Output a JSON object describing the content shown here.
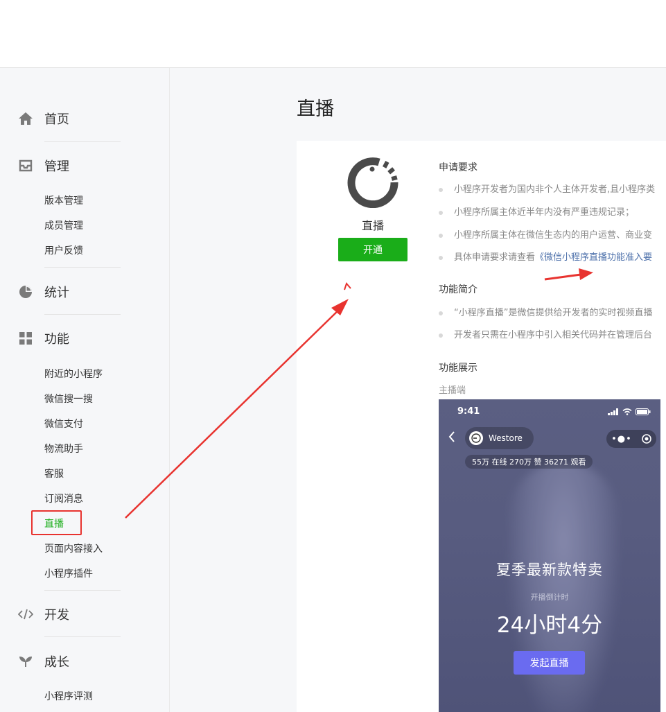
{
  "sidebar": {
    "sections": [
      {
        "label": "首页",
        "icon": "home-icon"
      },
      {
        "label": "管理",
        "icon": "inbox-icon",
        "items": [
          "版本管理",
          "成员管理",
          "用户反馈"
        ]
      },
      {
        "label": "统计",
        "icon": "pie-chart-icon"
      },
      {
        "label": "功能",
        "icon": "grid-icon",
        "items": [
          "附近的小程序",
          "微信搜一搜",
          "微信支付",
          "物流助手",
          "客服",
          "订阅消息",
          "直播",
          "页面内容接入",
          "小程序插件"
        ]
      },
      {
        "label": "开发",
        "icon": "code-icon"
      },
      {
        "label": "成长",
        "icon": "sprout-icon",
        "items": [
          "小程序评测"
        ]
      }
    ],
    "active_item": "直播"
  },
  "main": {
    "title": "直播",
    "plugin": {
      "name": "直播",
      "open_button": "开通"
    },
    "requirements_title": "申请要求",
    "requirements": [
      "小程序开发者为国内非个人主体开发者,且小程序类",
      "小程序所属主体近半年内没有严重违规记录；",
      "小程序所属主体在微信生态内的用户运营、商业变"
    ],
    "req_link_prefix": "具体申请要求请查看",
    "req_link_text": "《微信小程序直播功能准入要",
    "intro_title": "功能简介",
    "intro": [
      "“小程序直播”是微信提供给开发者的实时视频直播",
      "开发者只需在小程序中引入相关代码并在管理后台"
    ],
    "showcase_title": "功能展示",
    "showcase_sub": "主播端"
  },
  "phone": {
    "time": "9:41",
    "store": "Westore",
    "stats": "55万 在线  270万 赞  36271 观看",
    "headline": "夏季最新款特卖",
    "countdown_label": "开播倒计时",
    "countdown": "24小时4分",
    "start_button": "发起直播"
  },
  "colors": {
    "accent_green": "#1aad19",
    "annotation_red": "#e8332f",
    "link": "#4a6ea9",
    "phone_button": "#6a6bf0"
  }
}
